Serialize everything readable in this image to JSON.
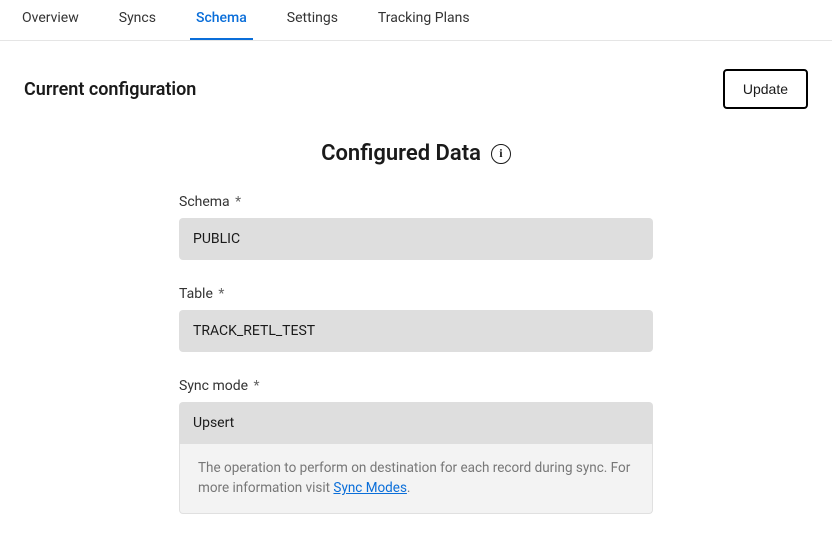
{
  "tabs": {
    "items": [
      "Overview",
      "Syncs",
      "Schema",
      "Settings",
      "Tracking Plans"
    ],
    "active_index": 2
  },
  "header": {
    "title": "Current configuration",
    "update_label": "Update"
  },
  "section": {
    "title": "Configured Data"
  },
  "fields": {
    "schema": {
      "label": "Schema",
      "required_mark": "*",
      "value": "PUBLIC"
    },
    "table": {
      "label": "Table",
      "required_mark": "*",
      "value": "TRACK_RETL_TEST"
    },
    "sync_mode": {
      "label": "Sync mode",
      "required_mark": "*",
      "value": "Upsert",
      "helper_pre": "The operation to perform on destination for each record during sync. For more information visit ",
      "helper_link": "Sync Modes",
      "helper_post": "."
    }
  }
}
